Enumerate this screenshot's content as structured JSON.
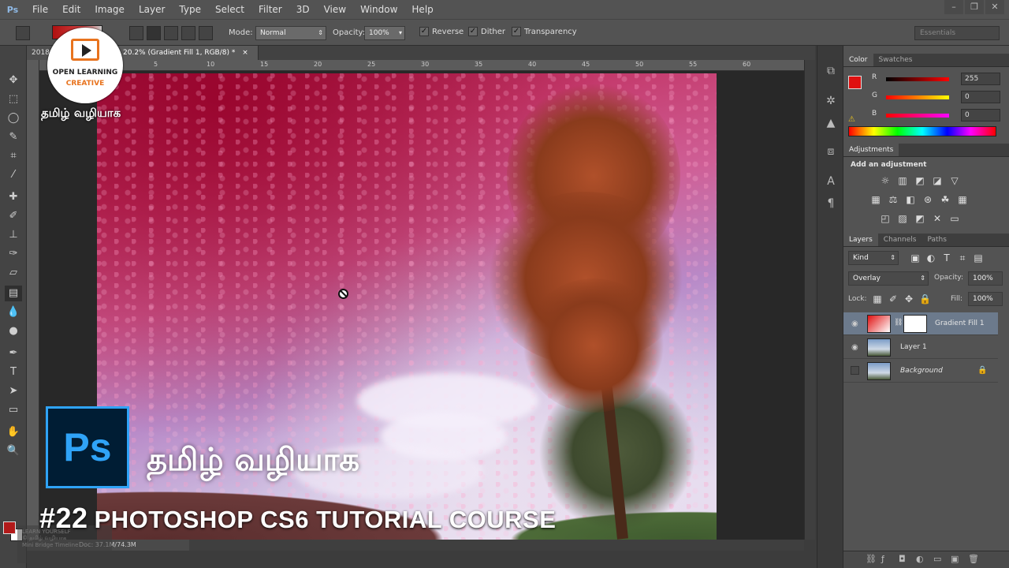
{
  "menu": {
    "app_logo": "Ps",
    "items": [
      "File",
      "Edit",
      "Image",
      "Layer",
      "Type",
      "Select",
      "Filter",
      "3D",
      "View",
      "Window",
      "Help"
    ]
  },
  "options": {
    "mode_label": "Mode:",
    "mode_value": "Normal",
    "opacity_label": "Opacity:",
    "opacity_value": "100%",
    "reverse": "Reverse",
    "dither": "Dither",
    "transparency": "Transparency",
    "workspace": "Essentials"
  },
  "tabs": {
    "first": "2018",
    "active": "20.2% (Gradient Fill 1, RGB/8) *",
    "close": "×"
  },
  "ruler_ticks": [
    "5",
    "10",
    "15",
    "20",
    "25",
    "30",
    "35",
    "40",
    "45",
    "50",
    "55",
    "60"
  ],
  "status": {
    "doc": "Doc: 37.1M/74.3M"
  },
  "color_panel": {
    "tab_color": "Color",
    "tab_swatches": "Swatches",
    "r_label": "R",
    "g_label": "G",
    "b_label": "B",
    "r_value": "255",
    "g_value": "0",
    "b_value": "0",
    "fg_color": "#e01010"
  },
  "adjustments": {
    "title": "Adjustments",
    "subtitle": "Add an adjustment"
  },
  "layers_panel": {
    "tab_layers": "Layers",
    "tab_channels": "Channels",
    "tab_paths": "Paths",
    "kind": "Kind",
    "blend_mode": "Overlay",
    "opacity_label": "Opacity:",
    "opacity_value": "100%",
    "lock_label": "Lock:",
    "fill_label": "Fill:",
    "fill_value": "100%",
    "layers": [
      {
        "name": "Gradient Fill 1",
        "visible": true,
        "selected": true
      },
      {
        "name": "Layer 1",
        "visible": true,
        "selected": false
      },
      {
        "name": "Background",
        "visible": false,
        "selected": false
      }
    ]
  },
  "branding": {
    "logo_line1": "OPEN LEARNING",
    "logo_line2": "CREATIVE",
    "tamil_small": "தமிழ் வழியாக",
    "ps_badge": "Ps",
    "tamil_big": "தமிழ் வழியாக",
    "episode": "#22",
    "course_title": "PHOTOSHOP CS6 TUTORIAL COURSE",
    "watermark_line1": "LEARN YOURSELF",
    "watermark_line2": "© தமிழ் வழியாக",
    "watermark_line3": "Mini Bridge    Timeline"
  }
}
